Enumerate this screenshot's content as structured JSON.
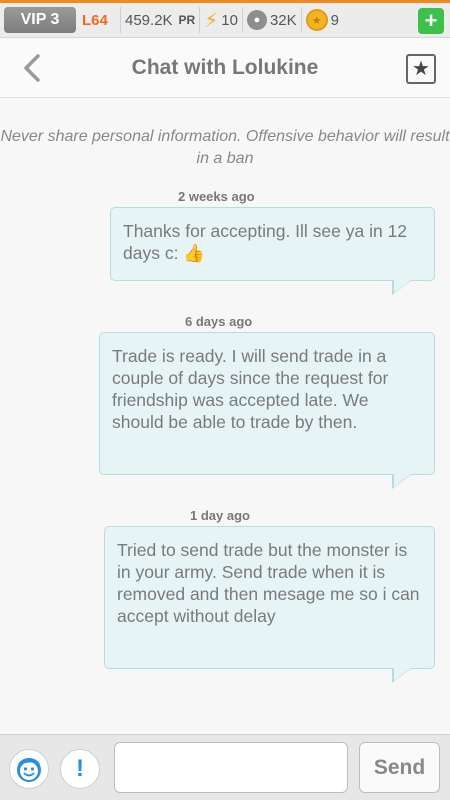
{
  "status_bar": {
    "vip": "VIP 3",
    "level": "L64",
    "power": "459.2K",
    "power_unit": "PR",
    "energy": "10",
    "food": "32K",
    "gems": "9",
    "add_label": "+",
    "icons": {
      "energy": "lightning-icon",
      "food": "paw-icon",
      "gems": "coin-icon"
    }
  },
  "header": {
    "title": "Chat with Lolukine",
    "back_icon": "chevron-left-icon",
    "favorite_icon": "star-icon"
  },
  "warning": "Never share personal information. Offensive behavior will result in a ban",
  "messages": [
    {
      "time": "2 weeks ago",
      "text": "Thanks for accepting. Ill see ya in 12 days c: 👍"
    },
    {
      "time": "6 days ago",
      "text": "Trade is ready. I will send trade in a couple of days since the request for friendship was accepted late. We should be able to trade by then."
    },
    {
      "time": "1 day ago",
      "text": "Tried to send trade but the monster is in your army. Send trade when it is removed and then mesage me so i can accept without delay"
    }
  ],
  "composer": {
    "input_value": "",
    "input_placeholder": "",
    "send_label": "Send",
    "report_label": "!",
    "emoji_icon": "face-icon"
  },
  "colors": {
    "accent": "#f08a1c",
    "level": "#ef6b1a",
    "bubble_bg": "#e6f4f6",
    "bubble_border": "#b6dce1",
    "add_button": "#3cc24b",
    "report_icon": "#2a8ee0"
  }
}
